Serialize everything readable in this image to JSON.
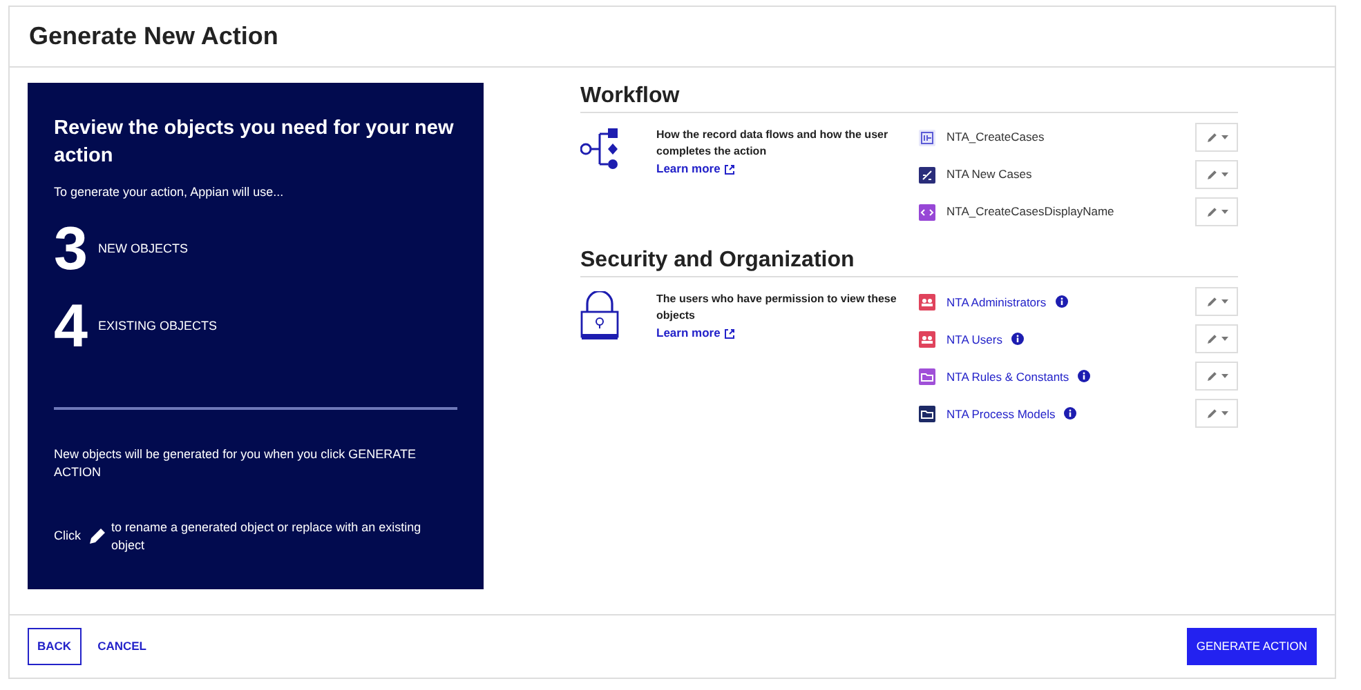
{
  "header": {
    "title": "Generate New Action"
  },
  "summary": {
    "title": "Review the objects you need for your new action",
    "intro": "To generate your action, Appian will use...",
    "counts": [
      {
        "number": "3",
        "label": "NEW OBJECTS"
      },
      {
        "number": "4",
        "label": "EXISTING OBJECTS"
      }
    ],
    "note": "New objects will be generated for you when you click GENERATE ACTION",
    "hint_before": "Click",
    "hint_after": "to rename a generated object or replace with an existing object"
  },
  "sections": [
    {
      "title": "Workflow",
      "kind": "workflow",
      "description": "How the record data flows and how the user completes the action",
      "link": "Learn more",
      "objects": [
        {
          "name": "NTA_CreateCases",
          "kind": "record",
          "info": false
        },
        {
          "name": "NTA New Cases",
          "kind": "process",
          "info": false
        },
        {
          "name": "NTA_CreateCasesDisplayName",
          "kind": "expression",
          "info": false
        }
      ]
    },
    {
      "title": "Security and Organization",
      "kind": "security",
      "description": "The users who have permission to view these objects",
      "link": "Learn more",
      "objects": [
        {
          "name": "NTA Administrators",
          "kind": "group",
          "info": true
        },
        {
          "name": "NTA Users",
          "kind": "group",
          "info": true
        },
        {
          "name": "NTA Rules & Constants",
          "kind": "folder",
          "info": true
        },
        {
          "name": "NTA Process Models",
          "kind": "process-folder",
          "info": true
        }
      ]
    }
  ],
  "footer": {
    "back": "BACK",
    "cancel": "CANCEL",
    "generate": "GENERATE ACTION"
  }
}
